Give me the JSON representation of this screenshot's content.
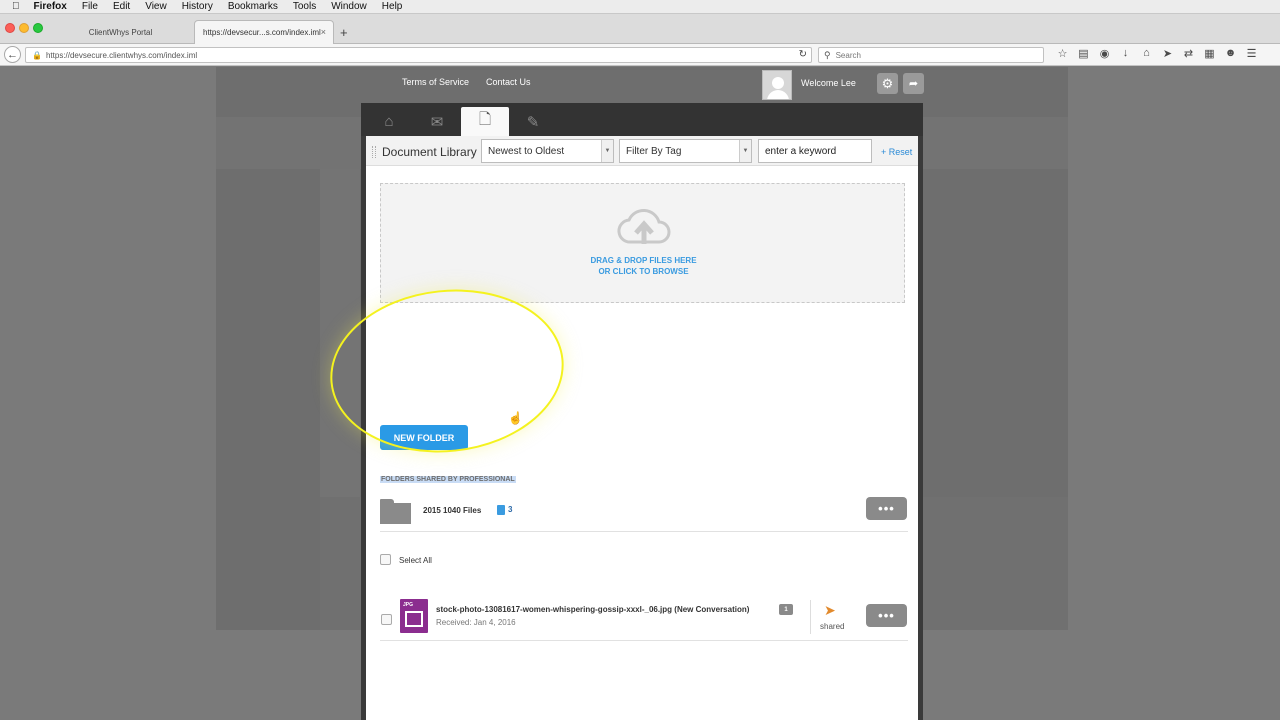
{
  "os_menu": {
    "apple_icon": "apple-icon",
    "items": [
      "Firefox",
      "File",
      "Edit",
      "View",
      "History",
      "Bookmarks",
      "Tools",
      "Window",
      "Help"
    ]
  },
  "browser": {
    "tabs": [
      {
        "title": "ClientWhys Portal",
        "active": false
      },
      {
        "title": "https://devsecur...s.com/index.iml",
        "active": true,
        "close": "×"
      }
    ],
    "new_tab": "+",
    "url": "https://devsecure.clientwhys.com/index.iml",
    "search_placeholder": "Search",
    "toolbar_icons": [
      "star-icon",
      "reading-list-icon",
      "pocket-icon",
      "download-icon",
      "home-icon",
      "send-icon",
      "back-forward-icon",
      "extension-icon",
      "chat-icon",
      "menu-icon"
    ]
  },
  "portal_header": {
    "terms": "Terms of Service",
    "contact": "Contact Us",
    "welcome": "Welcome Lee"
  },
  "modal": {
    "tabs": [
      {
        "icon": "home-icon"
      },
      {
        "icon": "chat-bubbles-icon"
      },
      {
        "icon": "documents-icon",
        "active": true
      },
      {
        "icon": "clipboard-signature-icon"
      }
    ]
  },
  "document_library": {
    "title": "Document Library",
    "sort_selected": "Newest to Oldest",
    "tag_filter_selected": "Filter By Tag",
    "keyword_value": "enter a keyword",
    "reset_label": "+ Reset",
    "dropzone_line1": "DRAG & DROP FILES HERE",
    "dropzone_line2": "OR CLICK TO BROWSE",
    "new_folder_label": "NEW FOLDER",
    "shared_heading": "FOLDERS SHARED BY PROFESSIONAL",
    "folders": [
      {
        "name": "2015 1040 Files",
        "file_count": "3",
        "more": "•••"
      }
    ],
    "select_all_label": "Select All",
    "files": [
      {
        "name": "stock-photo-13081617-women-whispering-gossip-xxxl-_06.jpg (New Conversation)",
        "type_label": "JPG",
        "comments": "1",
        "received": "Received: Jan 4, 2016",
        "shared_label": "shared",
        "more": "•••"
      }
    ]
  }
}
